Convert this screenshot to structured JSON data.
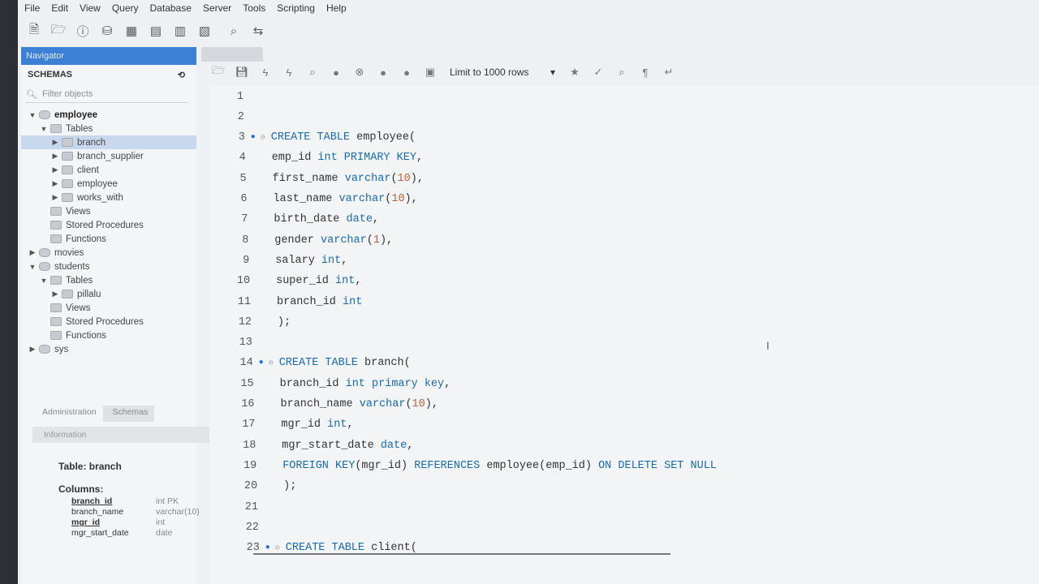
{
  "menu": [
    "File",
    "Edit",
    "View",
    "Query",
    "Database",
    "Server",
    "Tools",
    "Scripting",
    "Help"
  ],
  "navigator": {
    "header": "Navigator",
    "schemas_label": "SCHEMAS",
    "filter_placeholder": "Filter objects",
    "tree": [
      {
        "label": "employee",
        "level": 0,
        "arrow": "▼",
        "type": "db",
        "bold": true
      },
      {
        "label": "Tables",
        "level": 1,
        "arrow": "▼",
        "type": "folder"
      },
      {
        "label": "branch",
        "level": 2,
        "arrow": "▶",
        "type": "table",
        "selected": true
      },
      {
        "label": "branch_supplier",
        "level": 2,
        "arrow": "▶",
        "type": "table"
      },
      {
        "label": "client",
        "level": 2,
        "arrow": "▶",
        "type": "table"
      },
      {
        "label": "employee",
        "level": 2,
        "arrow": "▶",
        "type": "table"
      },
      {
        "label": "works_with",
        "level": 2,
        "arrow": "▶",
        "type": "table"
      },
      {
        "label": "Views",
        "level": 1,
        "arrow": "",
        "type": "folder"
      },
      {
        "label": "Stored Procedures",
        "level": 1,
        "arrow": "",
        "type": "folder"
      },
      {
        "label": "Functions",
        "level": 1,
        "arrow": "",
        "type": "folder"
      },
      {
        "label": "movies",
        "level": 0,
        "arrow": "▶",
        "type": "db"
      },
      {
        "label": "students",
        "level": 0,
        "arrow": "▼",
        "type": "db"
      },
      {
        "label": "Tables",
        "level": 1,
        "arrow": "▼",
        "type": "folder"
      },
      {
        "label": "pillalu",
        "level": 2,
        "arrow": "▶",
        "type": "table"
      },
      {
        "label": "Views",
        "level": 1,
        "arrow": "",
        "type": "folder"
      },
      {
        "label": "Stored Procedures",
        "level": 1,
        "arrow": "",
        "type": "folder"
      },
      {
        "label": "Functions",
        "level": 1,
        "arrow": "",
        "type": "folder"
      },
      {
        "label": "sys",
        "level": 0,
        "arrow": "▶",
        "type": "db"
      }
    ],
    "bottom_tabs": [
      "Administration",
      "Schemas"
    ],
    "info_header": "Information",
    "info_title": "Table: branch",
    "columns_label": "Columns:",
    "columns": [
      {
        "name": "branch_id",
        "type": "int PK",
        "bold": true
      },
      {
        "name": "branch_name",
        "type": "varchar(10)",
        "bold": false
      },
      {
        "name": "mgr_id",
        "type": "int",
        "bold": true
      },
      {
        "name": "mgr_start_date",
        "type": "date",
        "bold": false
      }
    ]
  },
  "editor_toolbar": {
    "limit_label": "Limit to 1000 rows"
  },
  "editor": {
    "lines": [
      {
        "n": 1,
        "tokens": []
      },
      {
        "n": 2,
        "tokens": []
      },
      {
        "n": 3,
        "dot": true,
        "fold": true,
        "tokens": [
          [
            "kw",
            "CREATE TABLE"
          ],
          [
            "t",
            " employee("
          ]
        ]
      },
      {
        "n": 4,
        "tokens": [
          [
            "t",
            "emp_id "
          ],
          [
            "kw",
            "int PRIMARY KEY"
          ],
          [
            "t",
            ","
          ]
        ]
      },
      {
        "n": 5,
        "tokens": [
          [
            "t",
            "first_name "
          ],
          [
            "kw",
            "varchar"
          ],
          [
            "t",
            "("
          ],
          [
            "num",
            "10"
          ],
          [
            "t",
            "),"
          ]
        ]
      },
      {
        "n": 6,
        "tokens": [
          [
            "t",
            "last_name "
          ],
          [
            "kw",
            "varchar"
          ],
          [
            "t",
            "("
          ],
          [
            "num",
            "10"
          ],
          [
            "t",
            "),"
          ]
        ]
      },
      {
        "n": 7,
        "tokens": [
          [
            "t",
            "birth_date "
          ],
          [
            "kw",
            "date"
          ],
          [
            "t",
            ","
          ]
        ]
      },
      {
        "n": 8,
        "tokens": [
          [
            "t",
            "gender "
          ],
          [
            "kw",
            "varchar"
          ],
          [
            "t",
            "("
          ],
          [
            "num",
            "1"
          ],
          [
            "t",
            "),"
          ]
        ]
      },
      {
        "n": 9,
        "tokens": [
          [
            "t",
            "salary "
          ],
          [
            "kw",
            "int"
          ],
          [
            "t",
            ","
          ]
        ]
      },
      {
        "n": 10,
        "tokens": [
          [
            "t",
            "super_id "
          ],
          [
            "kw",
            "int"
          ],
          [
            "t",
            ","
          ]
        ]
      },
      {
        "n": 11,
        "tokens": [
          [
            "t",
            "branch_id "
          ],
          [
            "kw",
            "int"
          ]
        ]
      },
      {
        "n": 12,
        "tokens": [
          [
            "t",
            ");"
          ]
        ]
      },
      {
        "n": 13,
        "tokens": []
      },
      {
        "n": 14,
        "dot": true,
        "fold": true,
        "tokens": [
          [
            "kw",
            "CREATE TABLE"
          ],
          [
            "t",
            " branch("
          ]
        ]
      },
      {
        "n": 15,
        "tokens": [
          [
            "t",
            "branch_id "
          ],
          [
            "kw",
            "int primary key"
          ],
          [
            "t",
            ","
          ]
        ]
      },
      {
        "n": 16,
        "tokens": [
          [
            "t",
            "branch_name "
          ],
          [
            "kw",
            "varchar"
          ],
          [
            "t",
            "("
          ],
          [
            "num",
            "10"
          ],
          [
            "t",
            "),"
          ]
        ]
      },
      {
        "n": 17,
        "tokens": [
          [
            "t",
            "mgr_id "
          ],
          [
            "kw",
            "int"
          ],
          [
            "t",
            ","
          ]
        ]
      },
      {
        "n": 18,
        "tokens": [
          [
            "t",
            "mgr_start_date "
          ],
          [
            "kw",
            "date"
          ],
          [
            "t",
            ","
          ]
        ]
      },
      {
        "n": 19,
        "tokens": [
          [
            "kw",
            "FOREIGN KEY"
          ],
          [
            "t",
            "(mgr_id) "
          ],
          [
            "kw",
            "REFERENCES"
          ],
          [
            "t",
            " employee(emp_id) "
          ],
          [
            "kw",
            "ON DELETE SET NULL"
          ]
        ]
      },
      {
        "n": 20,
        "tokens": [
          [
            "t",
            ");"
          ]
        ]
      },
      {
        "n": 21,
        "tokens": []
      },
      {
        "n": 22,
        "tokens": []
      },
      {
        "n": 23,
        "dot": true,
        "fold": true,
        "tokens": [
          [
            "kw",
            "CREATE TABLE"
          ],
          [
            "t",
            " client("
          ]
        ]
      }
    ]
  }
}
